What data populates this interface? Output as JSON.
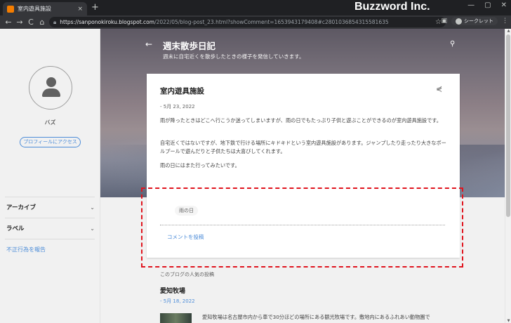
{
  "browser": {
    "tab_title": "室内遊具施設",
    "tab_close": "×",
    "new_tab": "+",
    "brand": "Buzzword Inc.",
    "window_controls": [
      "—",
      "▢",
      "✕"
    ],
    "nav": {
      "back": "←",
      "forward": "→",
      "reload": "C",
      "home": "⌂"
    },
    "url_host": "https://sanponokiroku.blogspot.com",
    "url_path": "/2022/05/blog-post_23.html?showComment=1653943179408#c2801036854315581635",
    "incognito_label": "シークレット"
  },
  "sidebar": {
    "author": "バズ",
    "profile_button": "プロフィールにアクセス",
    "items": [
      {
        "label": "アーカイブ",
        "chevron": "⌄"
      },
      {
        "label": "ラベル",
        "chevron": "⌄"
      }
    ],
    "report_link": "不正行為を報告"
  },
  "header": {
    "back_icon": "←",
    "title": "週末散歩日記",
    "description": "週末に自宅近くを散歩したときの様子を発信していきます。",
    "search_icon": "⚲"
  },
  "post": {
    "title": "室内遊具施設",
    "share_icon": "⋞",
    "date": "- 5月 23, 2022",
    "paragraphs": [
      "雨が降ったときはどこへ行こうか迷ってしまいますが、雨の日でもたっぷり子供と遊ぶことができるのが室内遊具施設です。",
      "自宅近くではないですが、地下鉄で行ける場所にキドキドという室内遊具施設があります。ジャンプしたり走ったり大きなボールプールで遊んだりと子供たちは大喜びしてくれます。",
      "雨の日にはまた行ってみたいです。"
    ],
    "tag": "雨の日",
    "comment_link": "コメントを投稿"
  },
  "popular": {
    "heading": "このブログの人気の投稿",
    "post_title": "愛知牧場",
    "post_date": "- 5月 18, 2022",
    "snippet": "愛知牧場は名古屋市内から車で30分ほどの場所にある観光牧場です。敷地内にあるふれあい動物園で"
  },
  "colors": {
    "accent": "#4c8cd8",
    "highlight": "#e0141e",
    "chrome_dark": "#1f2023"
  }
}
